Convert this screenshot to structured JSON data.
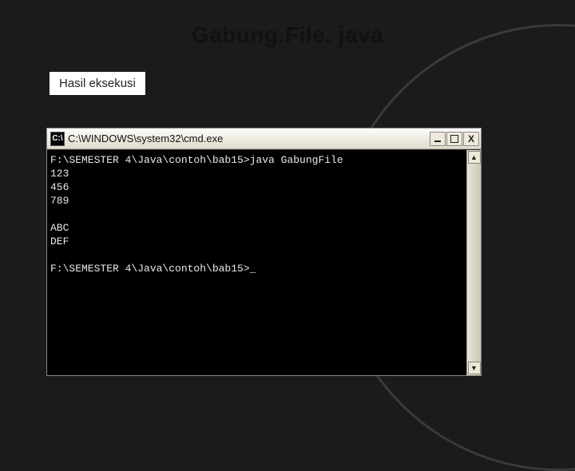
{
  "slide": {
    "title": "Gabung.File. java",
    "label": "Hasil eksekusi"
  },
  "cmd": {
    "icon_text": "C:\\",
    "title": "C:\\WINDOWS\\system32\\cmd.exe",
    "output": "F:\\SEMESTER 4\\Java\\contoh\\bab15>java GabungFile\n123\n456\n789\n\nABC\nDEF\n\nF:\\SEMESTER 4\\Java\\contoh\\bab15>_",
    "buttons": {
      "minimize": "Minimize",
      "maximize": "Maximize",
      "close": "X"
    },
    "scroll": {
      "up": "▲",
      "down": "▼"
    }
  }
}
